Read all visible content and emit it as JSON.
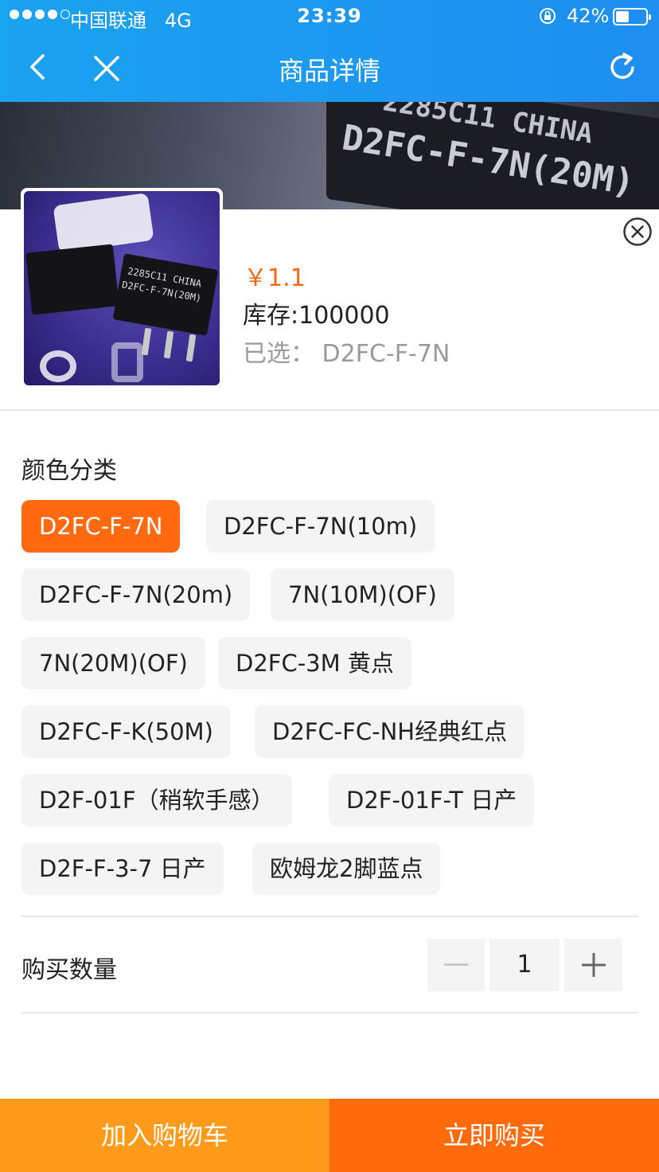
{
  "status_bar": {
    "carrier": "中国联通",
    "network": "4G",
    "time": "23:39",
    "battery_percent": "42%",
    "battery_level": 0.42
  },
  "nav": {
    "title": "商品详情",
    "icons": [
      "back-icon",
      "close-icon",
      "refresh-icon"
    ]
  },
  "banner": {
    "line1": "2285C11 CHINA",
    "line2": "D2FC-F-7N(20M)"
  },
  "product": {
    "price": "￥1.1",
    "stock": "库存:100000",
    "selected": "已选： D2FC-F-7N",
    "thumb_text1": "2285C11 CHINA",
    "thumb_text2": "D2FC-F-7N(20M)"
  },
  "variants": {
    "label": "颜色分类",
    "options": [
      "D2FC-F-7N",
      "D2FC-F-7N(10m)",
      "D2FC-F-7N(20m)",
      "7N(10M)(OF)",
      "7N(20M)(OF)",
      "D2FC-3M 黄点",
      "D2FC-F-K(50M)",
      "D2FC-FC-NH经典红点",
      "D2F-01F（稍软手感）",
      "D2F-01F-T 日产",
      "D2F-F-3-7 日产",
      "欧姆龙2脚蓝点"
    ],
    "selected_index": 0
  },
  "quantity": {
    "label": "购买数量",
    "value": "1"
  },
  "actions": {
    "add_to_cart": "加入购物车",
    "buy_now": "立即购买"
  },
  "colors": {
    "nav_blue": "#1e96f0",
    "accent_orange": "#ff6a10",
    "cart_orange": "#ff9a1a",
    "price_orange": "#f06c1c"
  }
}
